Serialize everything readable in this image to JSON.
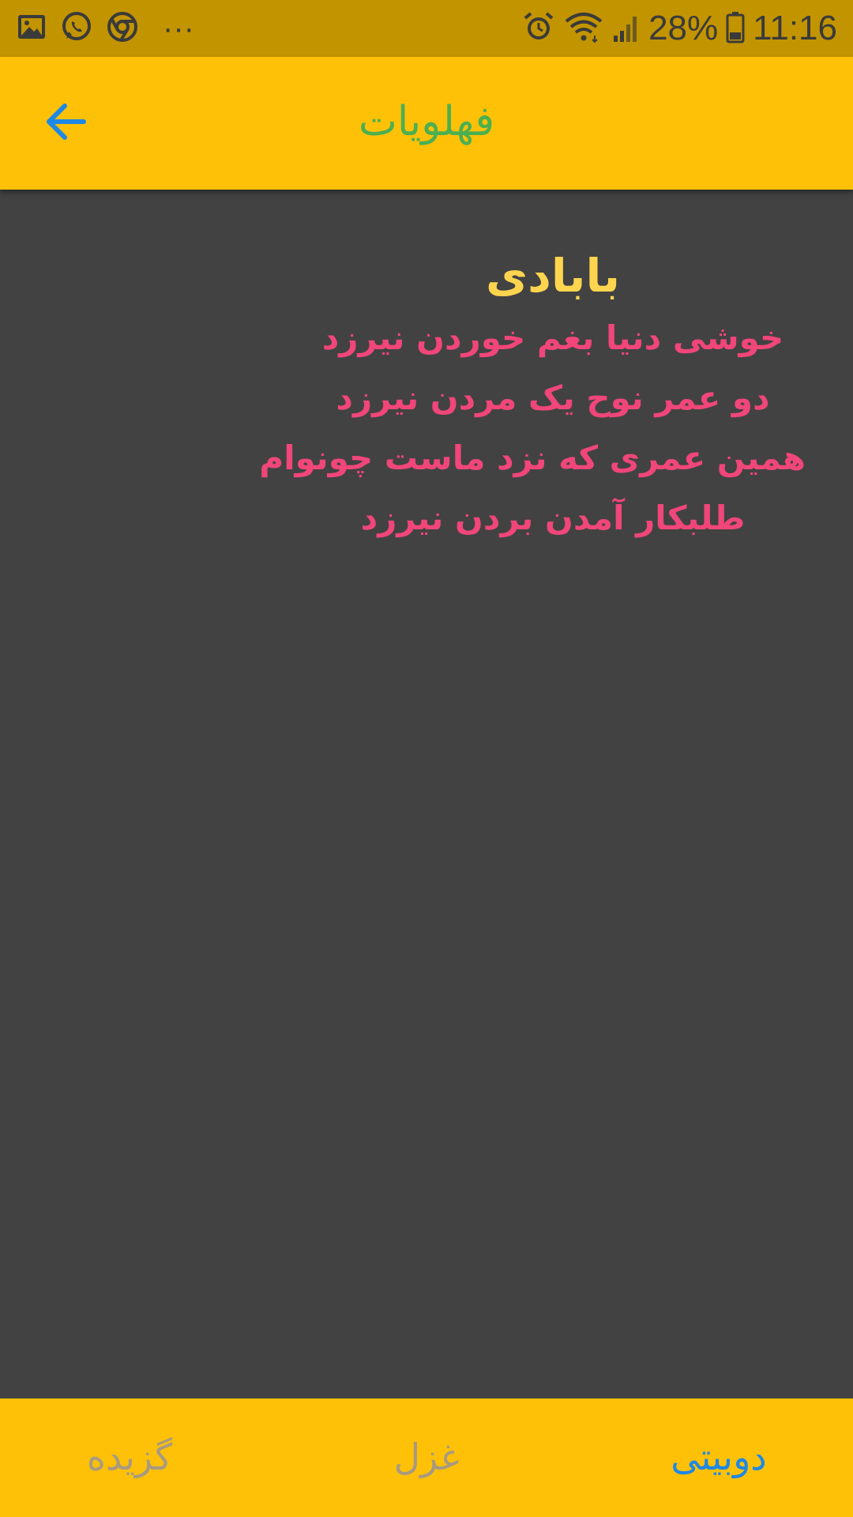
{
  "status_bar": {
    "battery_percent": "28%",
    "time": "11:16",
    "more_dots": "···",
    "left_icons": [
      "gallery-icon",
      "whatsapp-icon",
      "chrome-icon",
      "more-icon"
    ],
    "right_icons": [
      "alarm-icon",
      "wifi-icon",
      "signal-icon",
      "battery-icon"
    ]
  },
  "app_bar": {
    "title": "فهلویات",
    "back_icon": "arrow-left-icon",
    "title_color": "#4CAF50",
    "background": "#FFC107"
  },
  "poem": {
    "poet": "بابادی",
    "lines": [
      "خوشی دنیا بغم خوردن نیرزد",
      "دو عمر نوح یک مردن نیرزد",
      "همین عمری که نزد ماست چونوام",
      "طلبکار آمدن بردن نیرزد"
    ],
    "poet_color": "#FFD54F",
    "line_color": "#F0467A"
  },
  "bottom_nav": {
    "items": [
      {
        "label": "دوبیتی",
        "active": true
      },
      {
        "label": "غزل",
        "active": false
      },
      {
        "label": "گزیده",
        "active": false
      }
    ],
    "active_color": "#1E88E5",
    "inactive_color": "#A89A80"
  }
}
